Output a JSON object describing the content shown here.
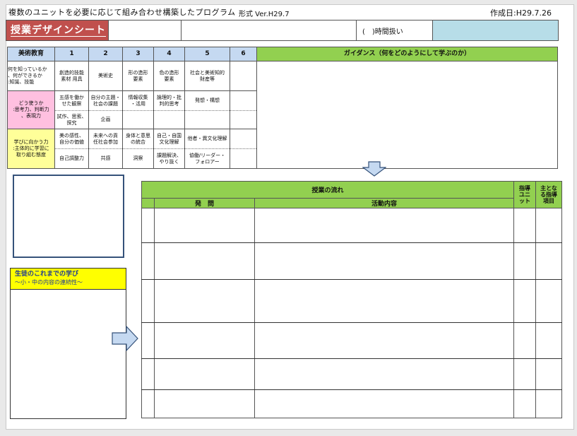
{
  "header": {
    "title": "複数のユニットを必要に応じて組み合わせ構築したプログラム",
    "version": "形式 Ver.H29.7",
    "date": "作成日:H29.7.26"
  },
  "band": {
    "sheet_title": "授業デザインシート",
    "hours": "(　)時間扱い",
    "accent_red": "#c0504d",
    "accent_blue": "#b7dde8"
  },
  "grid": {
    "subject": "美術教育",
    "columns": [
      "1",
      "2",
      "3",
      "4",
      "5",
      "6"
    ],
    "guidance": "ガイダンス（何をどのようにして学ぶのか）",
    "rows": [
      {
        "label": "何を知っているか\n、何ができるか\n:知識、技能",
        "cells": [
          "創造的技能\n素材 用具",
          "美術史",
          "形の造形\n要素",
          "色の造形\n要素",
          "社会と美術知的\n財産等",
          ""
        ]
      },
      {
        "label": "どう使うか\n:思考力、判断力\n、表現力",
        "cells_top": [
          "五感を働か\nせた観察",
          "自分の主題・\n社会の課題",
          "情報収集\n・活用",
          "論理的・批\n判的思考",
          "発想・構想",
          ""
        ],
        "cells_bottom": [
          "試作、思索、\n探究",
          "企画",
          "",
          "",
          "",
          ""
        ]
      },
      {
        "label": "学びに向かう力\n:主体的に学習に\n取り組む態度",
        "cells_top": [
          "美の感性、\n自分の価値",
          "未来への貢\n任社会参加",
          "身体と意思\nの統合",
          "自己・自国\n文化理解",
          "他者・異文化理解",
          ""
        ],
        "cells_bottom": [
          "自己調整力",
          "共感",
          "洞察",
          "課題解決、\nやり抜く",
          "協働/リーダー・\nフォロアー",
          ""
        ]
      }
    ]
  },
  "learning_box": {
    "title": "生徒のこれまでの学び",
    "subtitle": "〜小・中の内容の連続性〜",
    "color": "#ffff00"
  },
  "flow": {
    "title": "授業の流れ",
    "question": "発　問",
    "activity": "活動内容",
    "unit": "指導\nユニ\nット",
    "points": "主とな\nる指導\n項目",
    "color": "#92d050"
  }
}
